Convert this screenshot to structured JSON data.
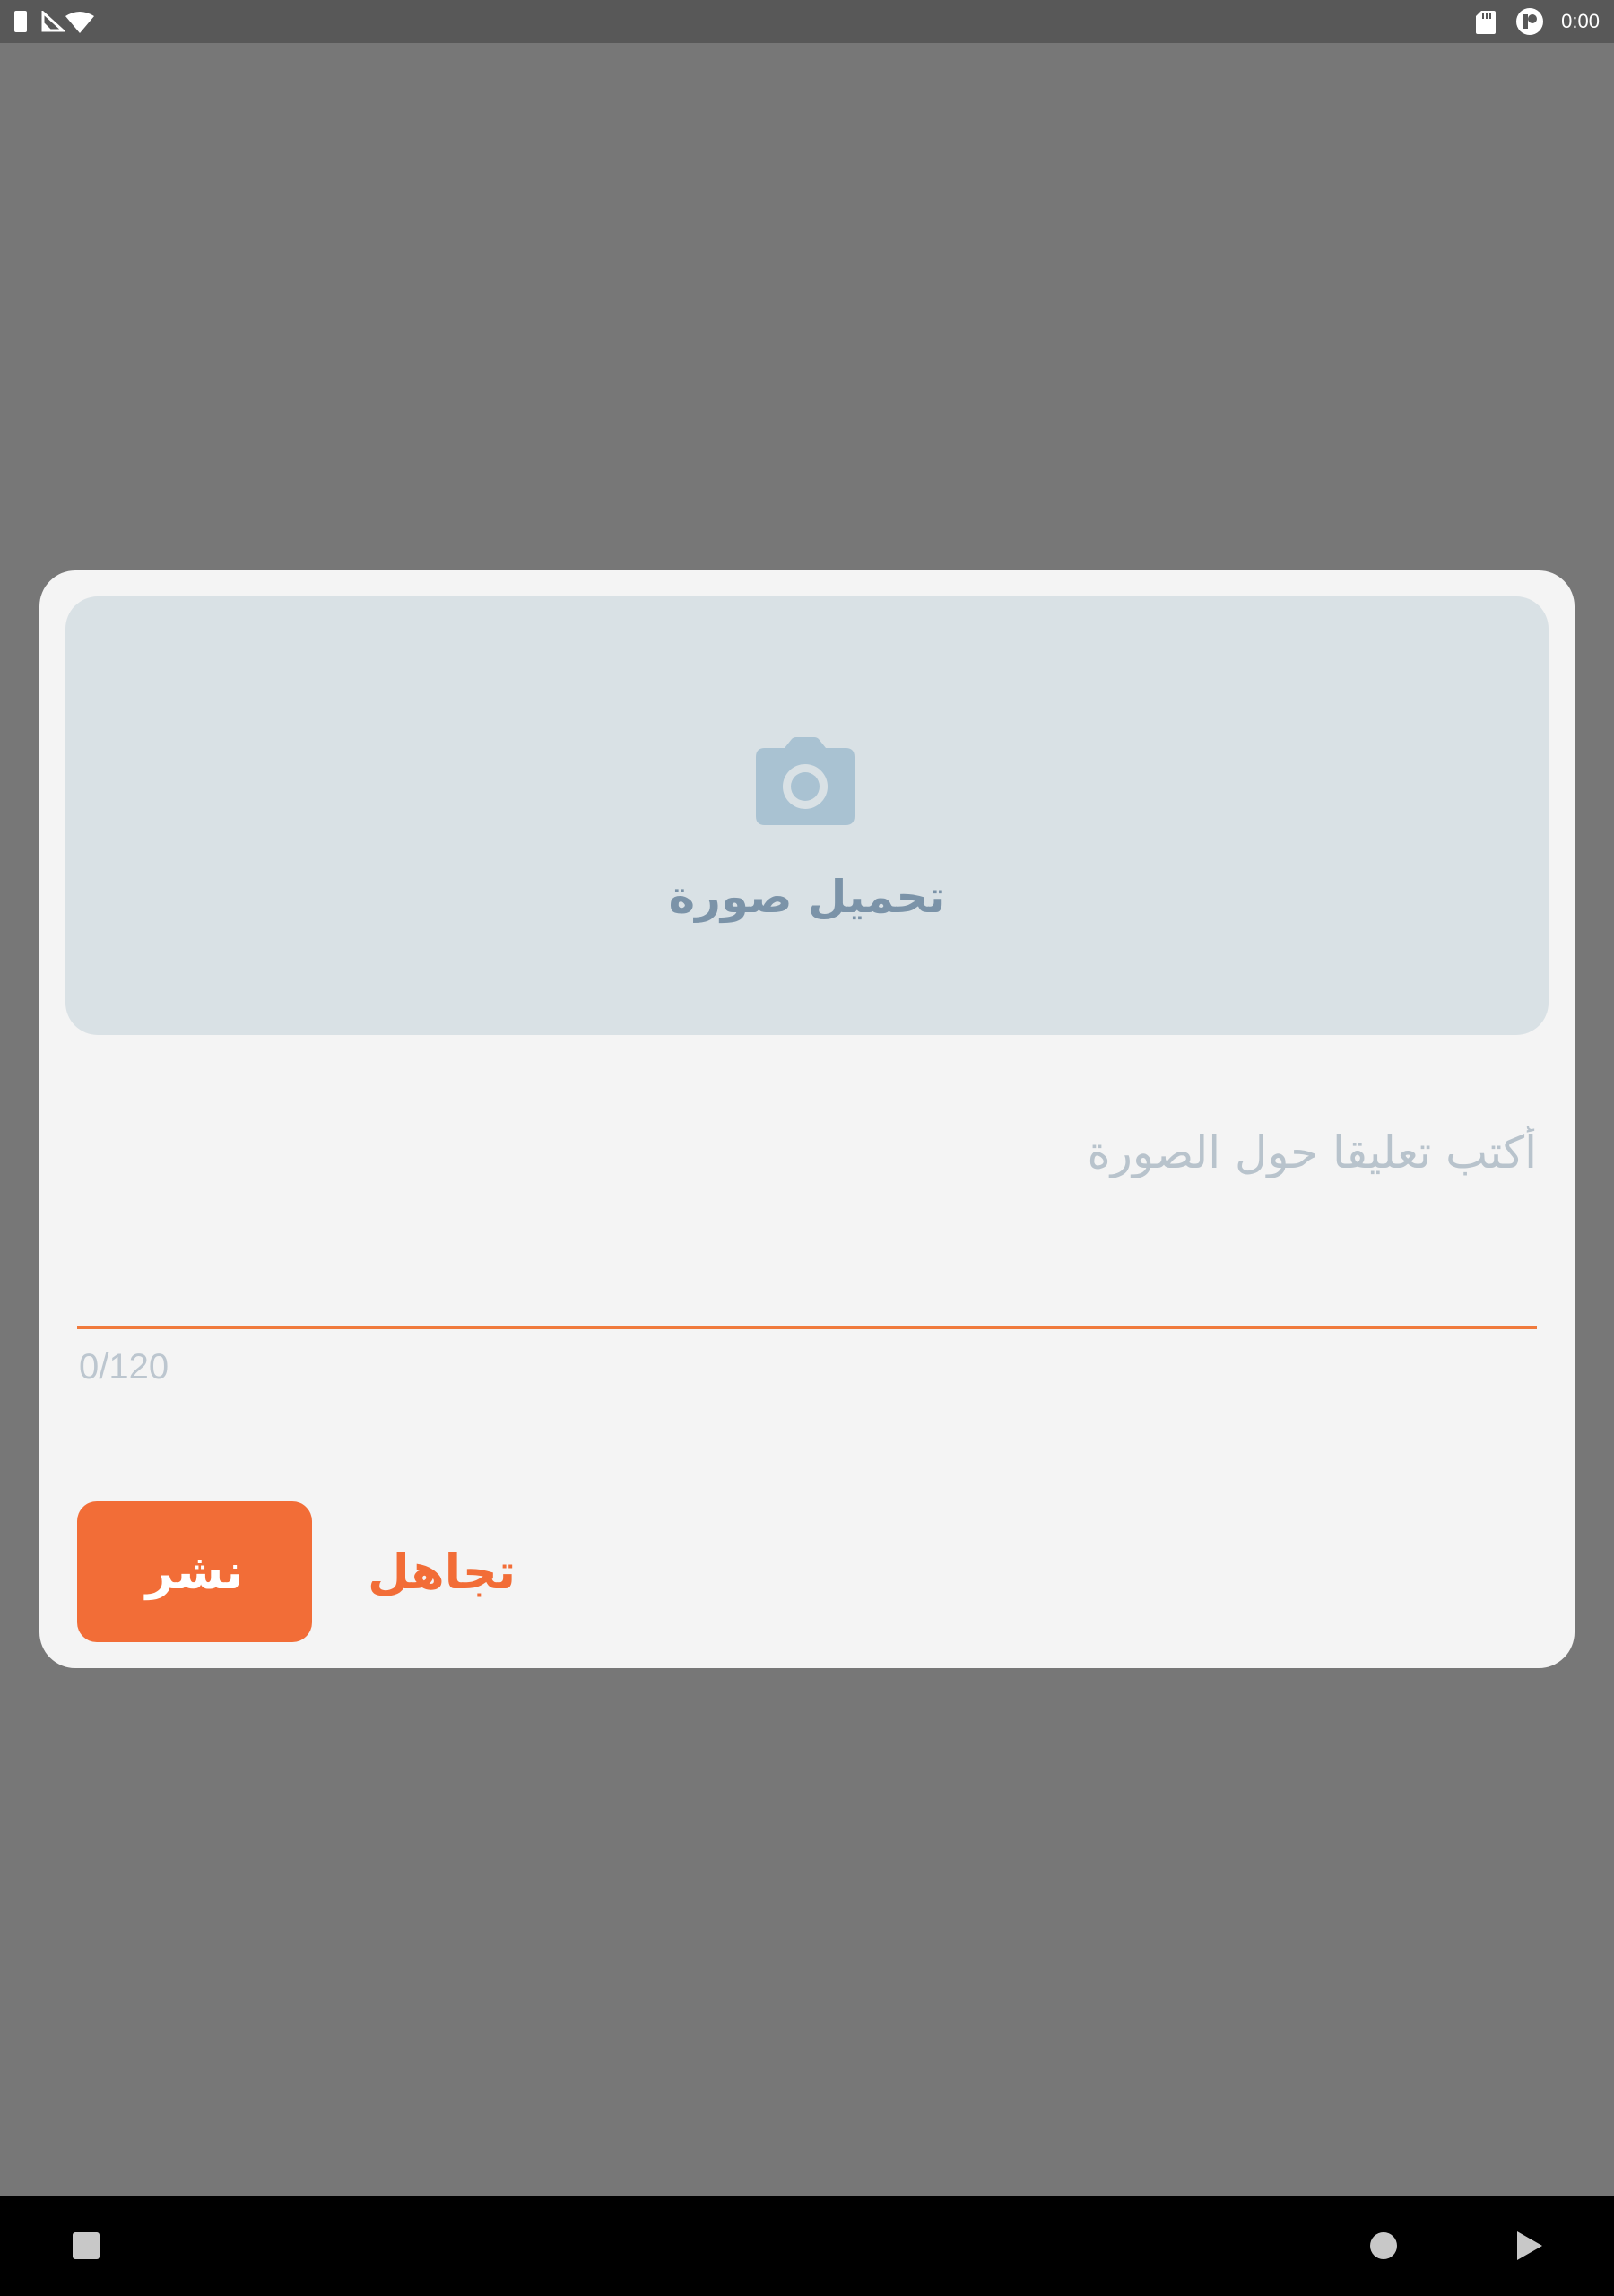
{
  "status_bar": {
    "time": "0:00",
    "icons": [
      "battery-icon",
      "signal-icon",
      "wifi-icon",
      "sdcard-icon",
      "sync-icon"
    ]
  },
  "dialog": {
    "upload": {
      "icon": "camera-icon",
      "label": "تحميل صورة"
    },
    "caption": {
      "value": "",
      "placeholder": "أكتب تعليقا حول الصورة",
      "counter": "0/120",
      "max_length": 120
    },
    "buttons": {
      "publish_label": "نشر",
      "ignore_label": "تجاهل"
    }
  },
  "nav_bar": {
    "icons": [
      "recents-icon",
      "home-icon",
      "back-icon"
    ]
  },
  "colors": {
    "accent": "#f26d37",
    "underline": "#f07a3c",
    "upload_bg": "#d9e1e5",
    "upload_text": "#7b93a8",
    "camera": "#a9c2d2",
    "dialog_bg": "#f4f4f4",
    "scrim": "#777777"
  }
}
